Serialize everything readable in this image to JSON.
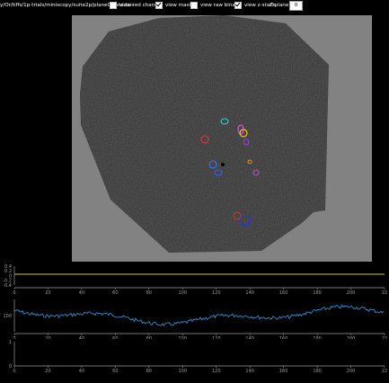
{
  "toolbar": {
    "file_path": "y/Or/tiffs/1p-trials/miniscopy/suite2p/plane0/data.bin",
    "view_red_channel": "view red channel",
    "view_masks": "view masks",
    "view_raw_binary": "view raw binary",
    "view_z_stack": "view z-stack",
    "z_plane_label": "Z-plane:",
    "z_plane_value": "0"
  },
  "toggles": {
    "view_red_channel": false,
    "view_masks": true,
    "view_raw_binary": false,
    "view_z_stack": true
  },
  "colors": {
    "background": "#000000",
    "panel": "#828282",
    "trace_yellow": "#c8c84a",
    "trace_blue": "#2b8fd0",
    "axis": "#9a9a9a"
  },
  "masks": [
    {
      "color": "#33cccc"
    },
    {
      "color": "#ee3333"
    },
    {
      "color": "#ff44ff"
    },
    {
      "color": "#ffdd00"
    },
    {
      "color": "#aa33ff"
    },
    {
      "color": "#3377ff"
    },
    {
      "color": "#2266ff"
    },
    {
      "color": "#cc44cc"
    },
    {
      "color": "#ff8800"
    },
    {
      "color": "#cc3333"
    },
    {
      "color": "#2233ee"
    }
  ],
  "plot1": {
    "y_ticks": [
      "0.4",
      "0.2",
      "0",
      "-0.2",
      "-0.4"
    ],
    "x_ticks": [
      "0",
      "20",
      "40",
      "60",
      "80",
      "100",
      "120",
      "140",
      "160",
      "180",
      "200",
      "22"
    ]
  },
  "plot2": {
    "y_ticks": [
      "100"
    ],
    "x_ticks": [
      "0",
      "20",
      "40",
      "60",
      "80",
      "100",
      "120",
      "140",
      "160",
      "180",
      "200",
      "22"
    ]
  },
  "plot3": {
    "y_ticks": [
      "1",
      "0"
    ],
    "x_ticks": [
      "0",
      "20",
      "40",
      "60",
      "80",
      "100",
      "120",
      "140",
      "160",
      "180",
      "200",
      "22"
    ]
  }
}
